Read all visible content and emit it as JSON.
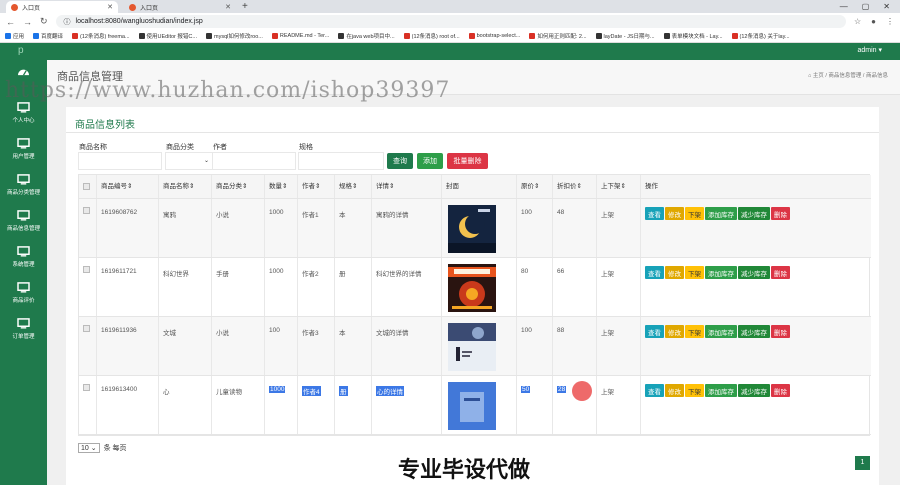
{
  "browser": {
    "tabs": [
      {
        "title": "入口页"
      },
      {
        "title": "入口页"
      }
    ],
    "url": "localhost:8080/wangluoshudian/index.jsp",
    "bookmarks": [
      "应用",
      "百度翻译",
      "(12条消息) freema...",
      "使用UEditor 报错C...",
      "mysql如何修改roo...",
      "README.md - Ter...",
      "在java web项目中...",
      "(12条消息) root of...",
      "bootstrap-select...",
      "如何用正则匹配: 2...",
      "layDate - JS日期与...",
      "表单模块文档 - Lay...",
      "(12条消息) 关于lay..."
    ]
  },
  "app": {
    "admin": "admin ▾",
    "logo_fragment": "p"
  },
  "sidebar": {
    "items": [
      {
        "label": ""
      },
      {
        "label": "个人中心"
      },
      {
        "label": "用户管理"
      },
      {
        "label": "商品分类管理"
      },
      {
        "label": "商品信息管理"
      },
      {
        "label": "系统管理"
      },
      {
        "label": "商品评价"
      },
      {
        "label": "订单管理"
      }
    ]
  },
  "page": {
    "title": "商品信息管理",
    "breadcrumb": "⌂ 主页 / 商品信息管理 / 商品信息"
  },
  "panel": {
    "title": "商品信息列表"
  },
  "filters": {
    "name_label": "商品名称",
    "category_label": "商品分类",
    "author_label": "作者",
    "spec_label": "规格",
    "query_button": "查询",
    "add_button": "添加",
    "batch_delete_button": "批量删除"
  },
  "table": {
    "headers": [
      "",
      "商品编号⇕",
      "商品名称⇕",
      "商品分类⇕",
      "数量⇕",
      "作者⇕",
      "规格⇕",
      "详情⇕",
      "封面",
      "原价⇕",
      "折扣价⇕",
      "上下架⇕",
      "操作"
    ],
    "rows": [
      {
        "id": "1619608762",
        "name": "寓鸦",
        "category": "小说",
        "qty": "1000",
        "author": "作者1",
        "spec": "本",
        "detail": "寓鸦的详情",
        "price": "100",
        "discount": "48",
        "status": "上架"
      },
      {
        "id": "1619611721",
        "name": "科幻世界",
        "category": "手册",
        "qty": "1000",
        "author": "作者2",
        "spec": "册",
        "detail": "科幻世界的详情",
        "price": "80",
        "discount": "66",
        "status": "上架"
      },
      {
        "id": "1619611936",
        "name": "文城",
        "category": "小说",
        "qty": "100",
        "author": "作者3",
        "spec": "本",
        "detail": "文城的详情",
        "price": "100",
        "discount": "88",
        "status": "上架"
      },
      {
        "id": "1619613400",
        "name": "心",
        "category": "儿童读物",
        "qty": "1000",
        "author": "作者4",
        "spec": "册",
        "detail": "心的详情",
        "price": "50",
        "discount": "28",
        "status": "上架"
      }
    ],
    "ops": [
      "查看",
      "修改",
      "下架",
      "添加库存",
      "减少库存",
      "删除"
    ]
  },
  "pager": {
    "page_size": "10",
    "per_page_label": "条 每页",
    "current_page": "1"
  },
  "watermarks": {
    "url": "https://www.huzhan.com/ishop39397",
    "cn": "专业毕设代做"
  }
}
